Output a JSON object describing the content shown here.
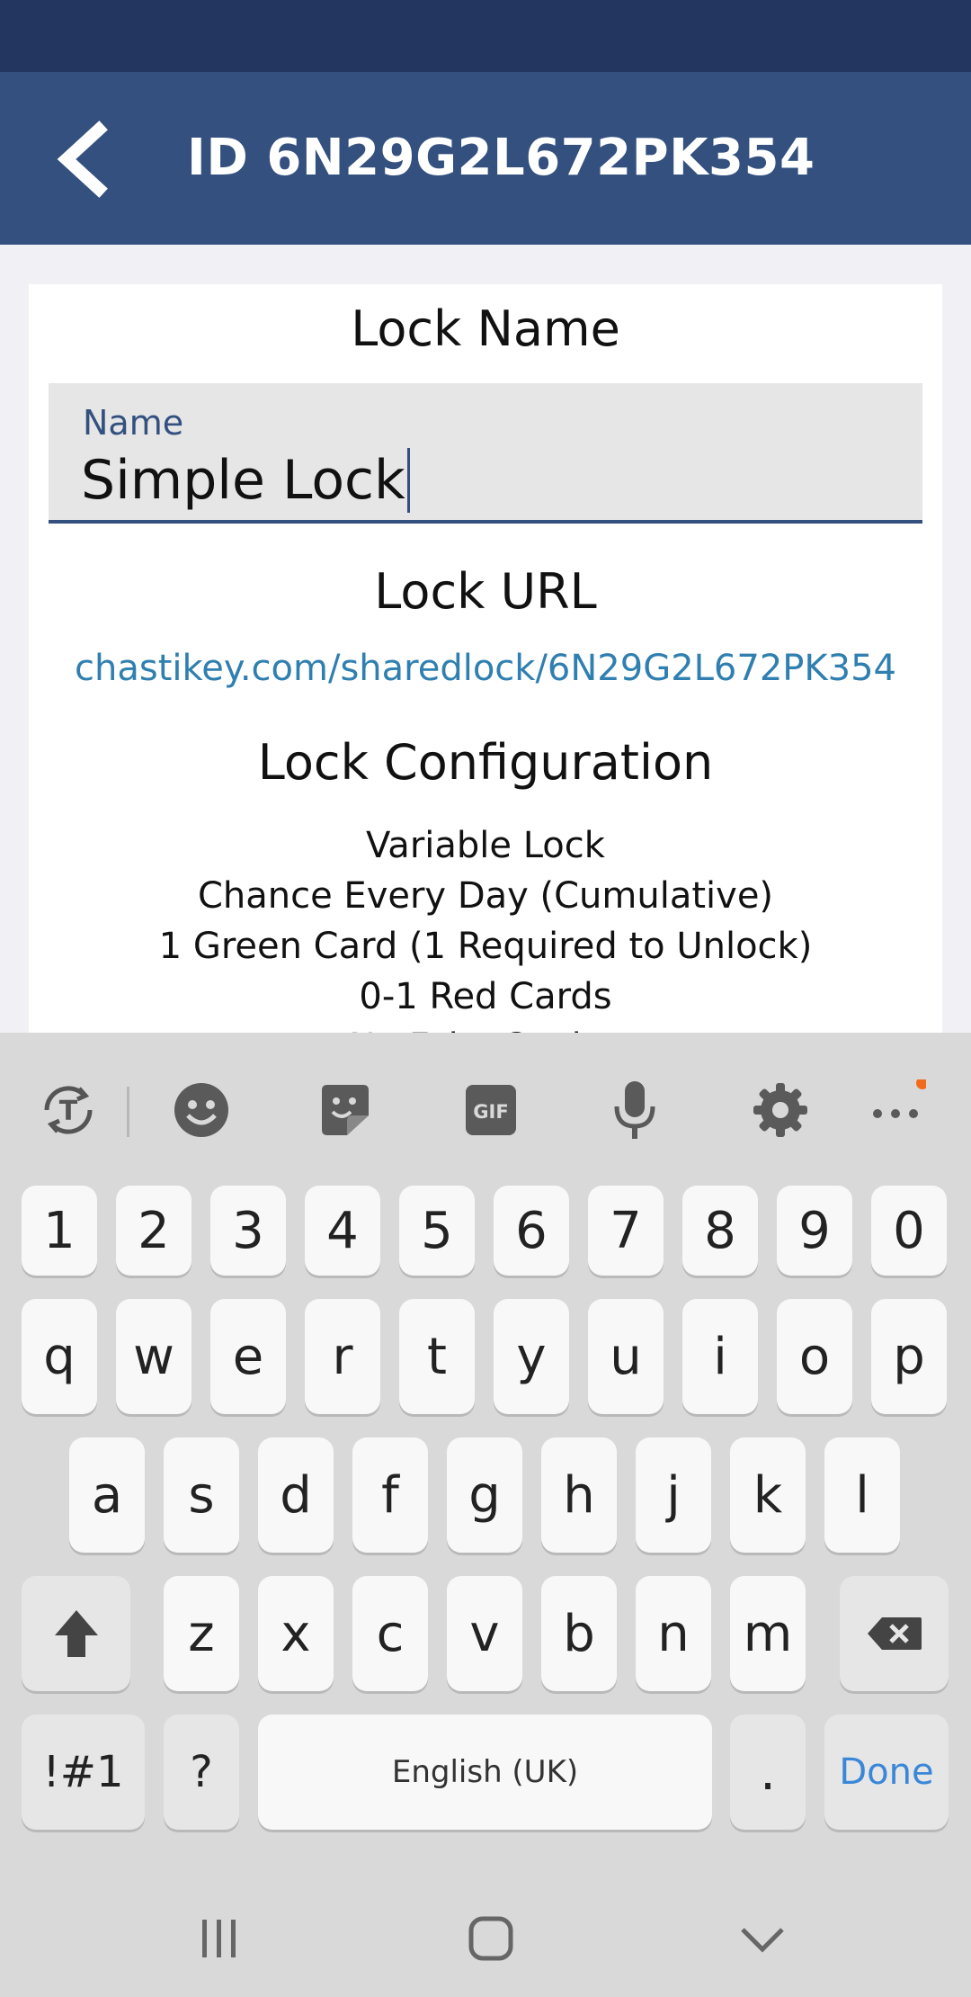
{
  "app_bar": {
    "title": "ID 6N29G2L672PK354",
    "back_icon": "chevron-left-icon"
  },
  "lock_name": {
    "heading": "Lock Name",
    "field_label": "Name",
    "field_value": "Simple Lock"
  },
  "lock_url": {
    "heading": "Lock URL",
    "url": "chastikey.com/sharedlock/6N29G2L672PK354"
  },
  "lock_configuration": {
    "heading": "Lock Configuration",
    "lines": [
      "Variable Lock",
      "Chance Every Day (Cumulative)",
      "1 Green Card (1 Required to Unlock)",
      "0-1 Red Cards",
      "No Fake Copies"
    ]
  },
  "keyboard": {
    "toolbar_icons": [
      "translate-icon",
      "emoji-icon",
      "sticker-icon",
      "gif-icon",
      "microphone-icon",
      "settings-icon",
      "more-icon"
    ],
    "gif_label": "GIF",
    "row_numbers": [
      "1",
      "2",
      "3",
      "4",
      "5",
      "6",
      "7",
      "8",
      "9",
      "0"
    ],
    "row_1": [
      "q",
      "w",
      "e",
      "r",
      "t",
      "y",
      "u",
      "i",
      "o",
      "p"
    ],
    "row_2": [
      "a",
      "s",
      "d",
      "f",
      "g",
      "h",
      "j",
      "k",
      "l"
    ],
    "row_3": [
      "z",
      "x",
      "c",
      "v",
      "b",
      "n",
      "m"
    ],
    "symbols_label": "!#1",
    "question_label": "?",
    "space_label": "English (UK)",
    "period_label": ".",
    "done_label": "Done",
    "accent_color": "#3a87d8",
    "notification_dot_color": "#f26b1d"
  },
  "colors": {
    "app_bar": "#33507f",
    "status_bar": "#223660",
    "link": "#2f7fb0"
  }
}
